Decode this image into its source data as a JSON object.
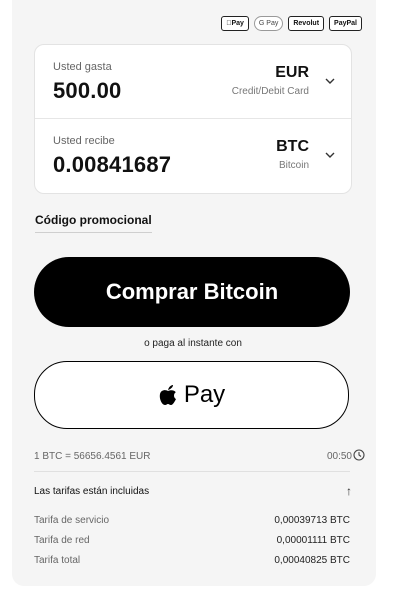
{
  "payment_methods": [
    "Pay",
    "G Pay",
    "Revolut",
    "PayPal"
  ],
  "spend": {
    "label": "Usted gasta",
    "amount": "500.00",
    "currency": "EUR",
    "method": "Credit/Debit Card"
  },
  "receive": {
    "label": "Usted recibe",
    "amount": "0.00841687",
    "currency": "BTC",
    "currency_name": "Bitcoin"
  },
  "promo_label": "Código promocional",
  "buy_button": "Comprar Bitcoin",
  "instant_text": "o paga al instante con",
  "apple_pay_label": "Pay",
  "rate": "1 BTC = 56656.4561 EUR",
  "timer": "00:50",
  "fees": {
    "header": "Las tarifas están incluidas",
    "items": [
      {
        "label": "Tarifa de servicio",
        "value": "0,00039713 BTC"
      },
      {
        "label": "Tarifa de red",
        "value": "0,00001111 BTC"
      },
      {
        "label": "Tarifa total",
        "value": "0,00040825 BTC"
      }
    ]
  },
  "colors": {
    "primary_button": "#000000",
    "panel_bg": "#f5f5f5"
  }
}
